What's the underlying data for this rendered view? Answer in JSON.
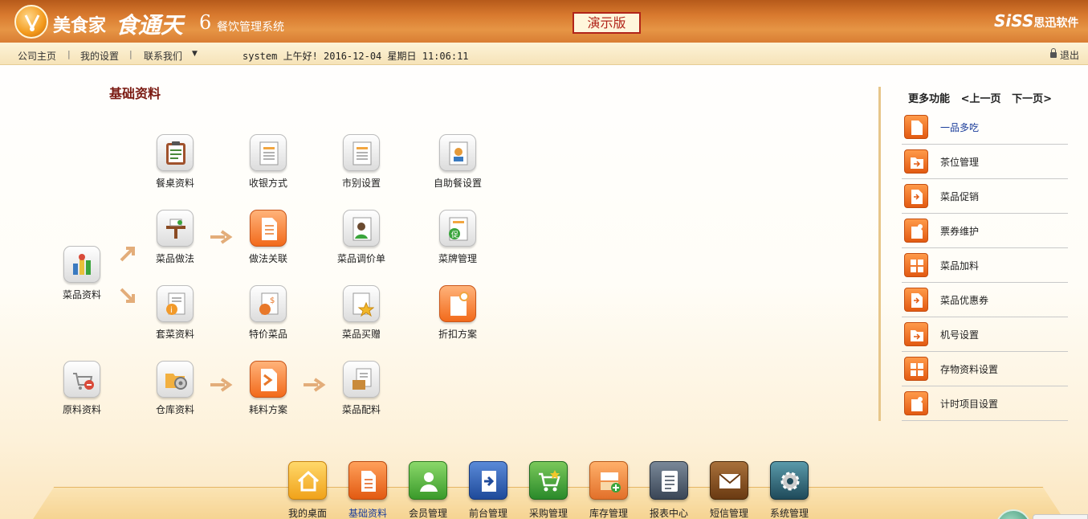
{
  "header": {
    "brand_main": "美食家",
    "brand_reg": "®",
    "brand_product": "食通天",
    "brand_version": "6",
    "brand_subtitle": "餐饮管理系统",
    "demo_label": "演示版",
    "vendor": "SiSS",
    "vendor_cn": "思迅软件"
  },
  "nav": {
    "home": "公司主页",
    "settings": "我的设置",
    "contact": "联系我们",
    "status": "system 上午好! 2016-12-04 星期日 11:06:11",
    "logout": "退出"
  },
  "section_title": "基础资料",
  "tiles": {
    "table_info": "餐桌资料",
    "payment_method": "收银方式",
    "market_setting": "市别设置",
    "buffet_setting": "自助餐设置",
    "dish_method": "菜品做法",
    "method_link": "做法关联",
    "price_adjust": "菜品调价单",
    "menu_card": "菜牌管理",
    "dish_info": "菜品资料",
    "set_meal": "套菜资料",
    "special_dish": "特价菜品",
    "dish_gift": "菜品买赠",
    "discount_plan": "折扣方案",
    "raw_material": "原料资料",
    "warehouse": "仓库资料",
    "consumption_plan": "耗料方案",
    "dish_ingredient": "菜品配料"
  },
  "more_panel": {
    "title": "更多功能",
    "prev": "<上一页",
    "next": "下一页>",
    "items": [
      {
        "label": "一品多吃"
      },
      {
        "label": "茶位管理"
      },
      {
        "label": "菜品促销"
      },
      {
        "label": "票券维护"
      },
      {
        "label": "菜品加料"
      },
      {
        "label": "菜品优惠券"
      },
      {
        "label": "机号设置"
      },
      {
        "label": "存物资料设置"
      },
      {
        "label": "计时项目设置"
      }
    ]
  },
  "dock": [
    {
      "label": "我的桌面",
      "color": "#f6b92b"
    },
    {
      "label": "基础资料",
      "color": "#f0701e"
    },
    {
      "label": "会员管理",
      "color": "#55b03a"
    },
    {
      "label": "前台管理",
      "color": "#2e64b0"
    },
    {
      "label": "采购管理",
      "color": "#3aa43c"
    },
    {
      "label": "库存管理",
      "color": "#e87a28"
    },
    {
      "label": "报表中心",
      "color": "#4a5766"
    },
    {
      "label": "短信管理",
      "color": "#7a4a22"
    },
    {
      "label": "系统管理",
      "color": "#2e6a7a"
    }
  ],
  "colors": {
    "header_orange": "#d8792e",
    "title_red": "#7a1a12",
    "arrow_tan": "#e3ad7a",
    "active_blue": "#1a3c9a"
  }
}
